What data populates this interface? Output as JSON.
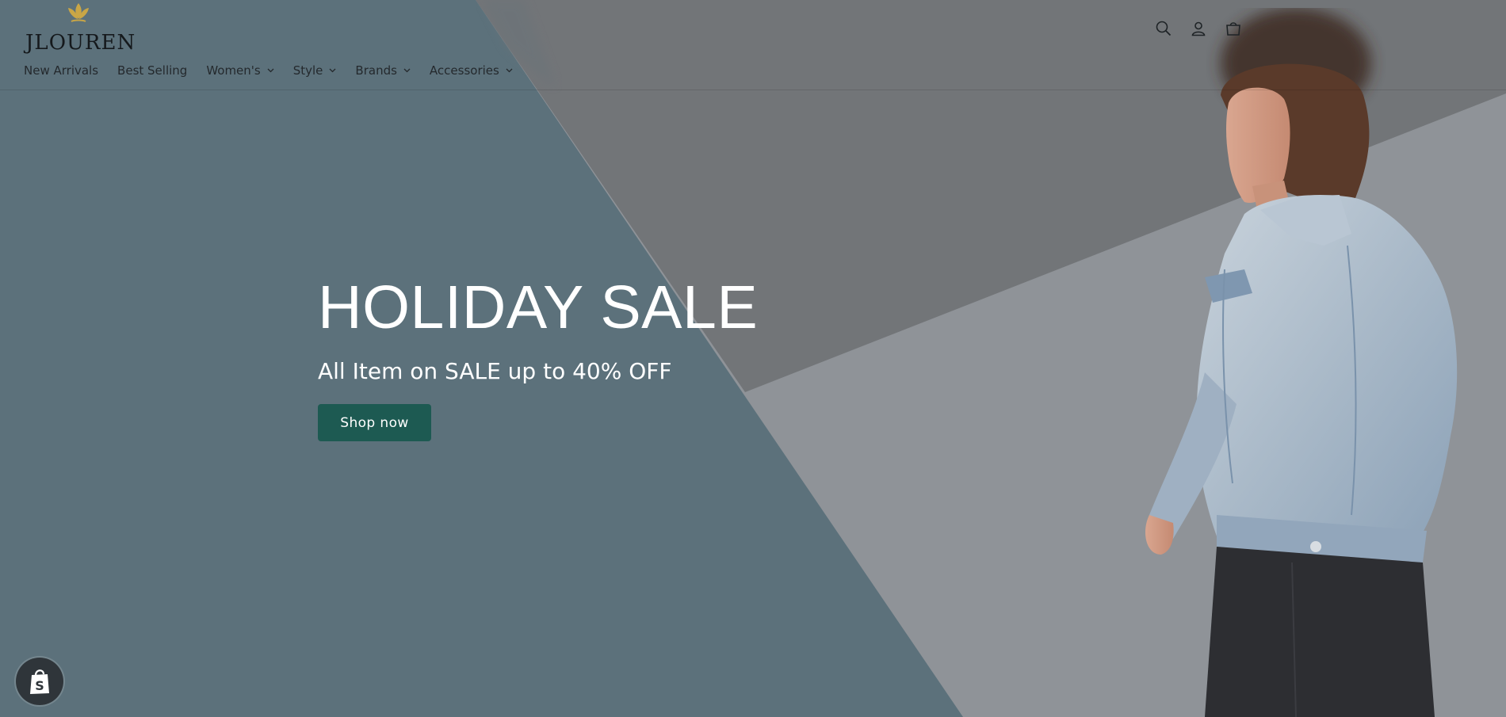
{
  "store": {
    "brand_name": "JLOUREN",
    "brand_accent": "#c9a646"
  },
  "nav": {
    "items": [
      {
        "label": "New Arrivals",
        "has_dropdown": false
      },
      {
        "label": "Best Selling",
        "has_dropdown": false
      },
      {
        "label": "Women's",
        "has_dropdown": true
      },
      {
        "label": "Style",
        "has_dropdown": true
      },
      {
        "label": "Brands",
        "has_dropdown": true
      },
      {
        "label": "Accessories",
        "has_dropdown": true
      }
    ]
  },
  "header_icons": [
    "search-icon",
    "account-icon",
    "cart-icon"
  ],
  "hero": {
    "title": "HOLIDAY SALE",
    "subtitle": "All Item on SALE up to 40% OFF",
    "cta_label": "Shop now",
    "colors": {
      "left_panel": "#5c717b",
      "upper_right": "#727578",
      "lower_right": "#8f9398",
      "button": "#1d5a52"
    }
  },
  "badge": {
    "icon": "shopify-bag-icon",
    "letter": "S"
  }
}
